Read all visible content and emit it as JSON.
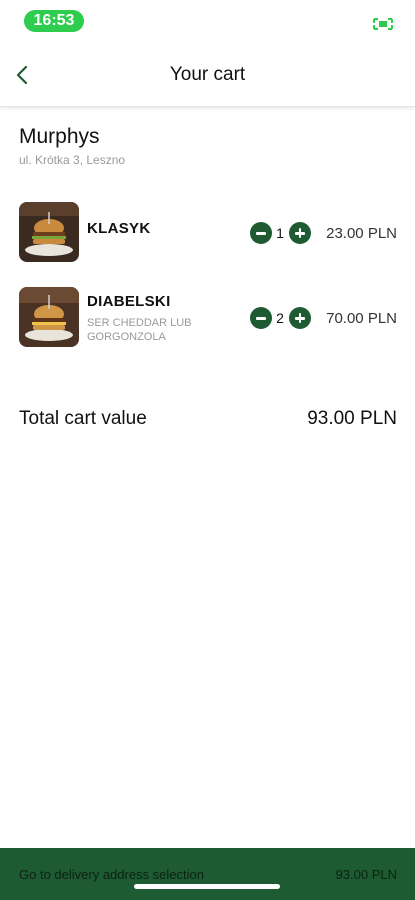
{
  "status_bar": {
    "time": "16:53",
    "battery_icon": "battery-charging-icon",
    "accent": "#2ecc4f"
  },
  "nav": {
    "title": "Your cart",
    "back_icon": "chevron-left-icon"
  },
  "restaurant": {
    "name": "Murphys",
    "address": "ul. Krótka 3, Leszno"
  },
  "items": [
    {
      "name": "KLASYK",
      "description": "",
      "quantity": "1",
      "price": "23.00 PLN",
      "image_icon": "burger-photo"
    },
    {
      "name": "DIABELSKI",
      "description": "SER CHEDDAR LUB GORGONZOLA",
      "quantity": "2",
      "price": "70.00 PLN",
      "image_icon": "burger-photo"
    }
  ],
  "total": {
    "label": "Total cart value",
    "value": "93.00 PLN"
  },
  "cta": {
    "label": "Go to delivery address selection",
    "price": "93.00 PLN"
  },
  "colors": {
    "brand": "#1e5b32",
    "status_pill": "#2ecc4f",
    "muted_text": "#9a9a9a"
  }
}
